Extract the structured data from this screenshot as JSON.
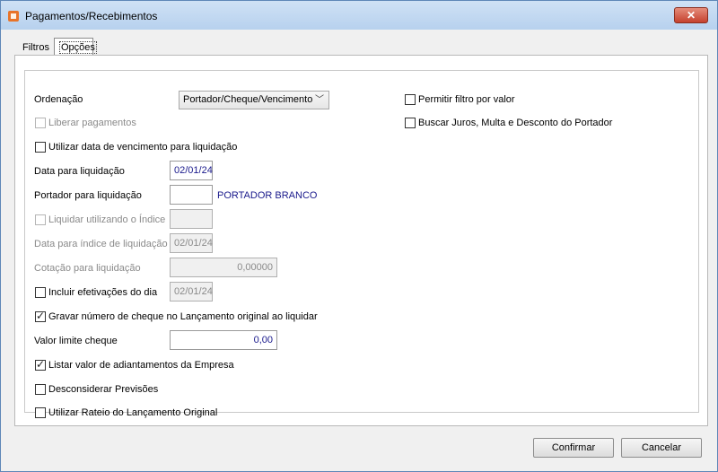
{
  "window": {
    "title": "Pagamentos/Recebimentos",
    "close_glyph": "✕"
  },
  "tabs": [
    {
      "label": "Filtros"
    },
    {
      "label": "Opções"
    }
  ],
  "form": {
    "ordenacao_label": "Ordenação",
    "ordenacao_value": "Portador/Cheque/Vencimento",
    "liberar_pagamentos": "Liberar pagamentos",
    "utilizar_data_vencimento": "Utilizar data de vencimento para liquidação",
    "data_liquidacao_label": "Data para liquidação",
    "data_liquidacao_value": "02/01/24",
    "portador_label": "Portador para liquidação",
    "portador_value": "",
    "portador_name": "PORTADOR BRANCO",
    "liquidar_indice": "Liquidar utilizando o Índice",
    "data_indice_label": "Data para índice de liquidação",
    "data_indice_value": "02/01/24",
    "cotacao_label": "Cotação para liquidação",
    "cotacao_value": "0,00000",
    "incluir_efetivacoes": "Incluir efetivações do dia",
    "incluir_efetivacoes_value": "02/01/24",
    "gravar_numero_cheque": "Gravar número de cheque no Lançamento original ao liquidar",
    "valor_limite_label": "Valor limite cheque",
    "valor_limite_value": "0,00",
    "listar_adiantamentos": "Listar valor de adiantamentos da Empresa",
    "desconsiderar_previsoes": "Desconsiderar Previsões",
    "utilizar_rateio": "Utilizar Rateio do Lançamento Original",
    "permitir_filtro_valor": "Permitir filtro por valor",
    "buscar_juros": "Buscar Juros, Multa e Desconto do Portador"
  },
  "buttons": {
    "confirmar": "Confirmar",
    "cancelar": "Cancelar"
  }
}
